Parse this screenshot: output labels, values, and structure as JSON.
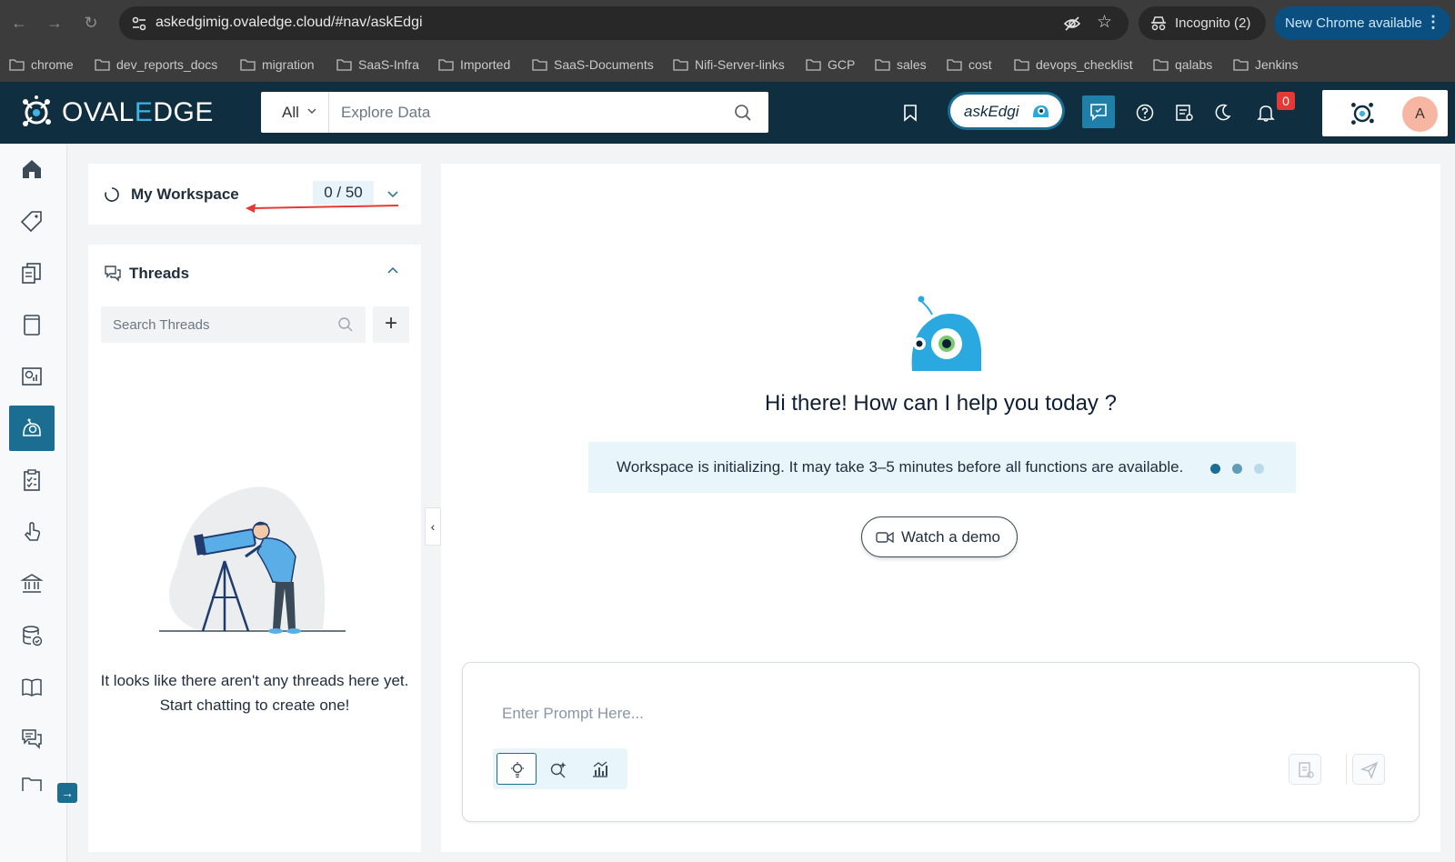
{
  "browser": {
    "url": "askedgimig.ovaledge.cloud/#nav/askEdgi",
    "incognito_label": "Incognito (2)",
    "update_label": "New Chrome available",
    "bookmarks": [
      "chrome",
      "dev_reports_docs",
      "migration",
      "SaaS-Infra",
      "Imported",
      "SaaS-Documents",
      "Nifi-Server-links",
      "GCP",
      "sales",
      "cost",
      "devops_checklist",
      "qalabs",
      "Jenkins"
    ]
  },
  "header": {
    "logo_prefix": "OVAL",
    "logo_accent": "E",
    "logo_suffix": "DGE",
    "search_scope": "All",
    "search_placeholder": "Explore Data",
    "askedgi_label": "askEdgi",
    "notification_count": "0",
    "avatar_initial": "A"
  },
  "sidebar": {
    "items": [
      "home-icon",
      "tag-icon",
      "documents-icon",
      "book-icon",
      "dashboard-icon",
      "askedgi-icon",
      "checklist-icon",
      "hand-pointer-icon",
      "bank-icon",
      "database-check-icon",
      "open-book-icon",
      "chat-icon",
      "folder-icon"
    ],
    "active_index": 5
  },
  "workspace": {
    "title": "My Workspace",
    "count": "0 / 50"
  },
  "threads": {
    "title": "Threads",
    "search_placeholder": "Search Threads",
    "add_label": "+",
    "empty_line1": "It looks like there aren't any threads here yet.",
    "empty_line2": "Start chatting to create one!"
  },
  "chat": {
    "greeting": "Hi there! How can I help you today ?",
    "init_message": "Workspace is initializing. It may take 3–5 minutes before all functions are available.",
    "demo_label": "Watch a demo",
    "prompt_placeholder": "Enter Prompt Here...",
    "modes": [
      "bulb-icon",
      "search-sparkle-icon",
      "chart-icon"
    ]
  },
  "colors": {
    "header_bg": "#0f2e3f",
    "accent": "#1b6d91",
    "banner_bg": "#e8f5fa",
    "badge_red": "#e53935",
    "annotation_arrow": "#e53935"
  }
}
